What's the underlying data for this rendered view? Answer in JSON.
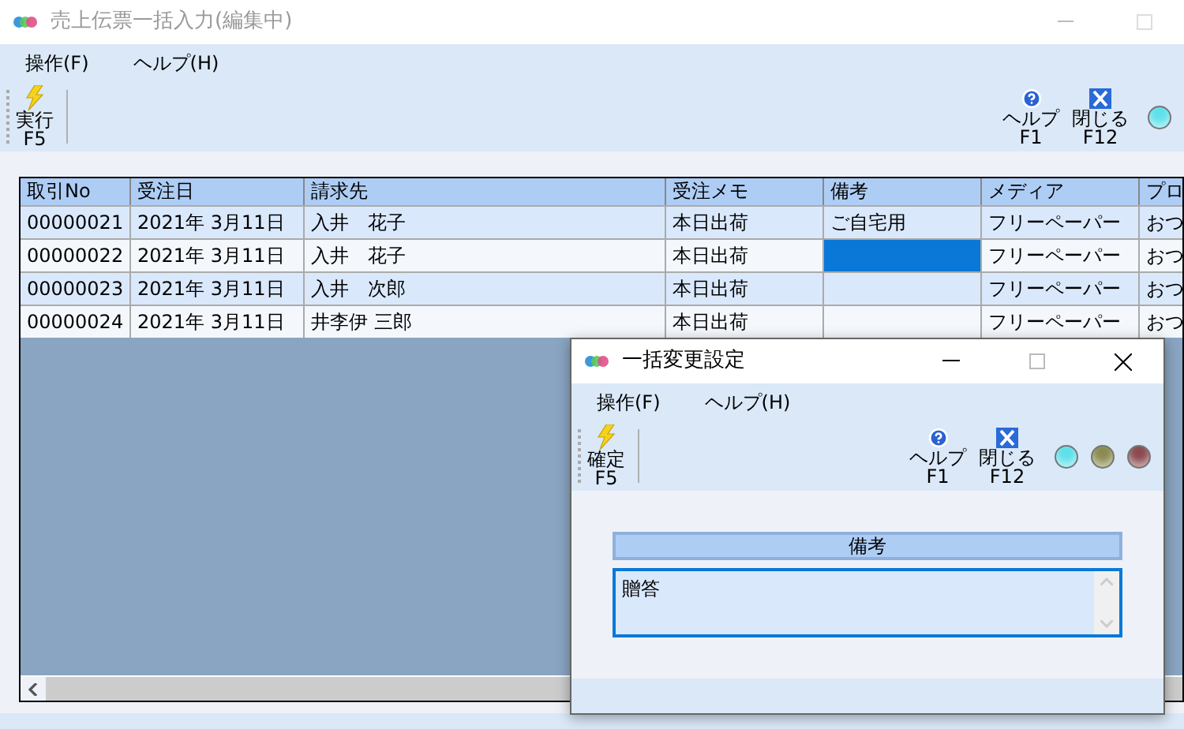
{
  "window": {
    "title": "売上伝票一括入力(編集中)"
  },
  "menu": [
    "操作(F)",
    "ヘルプ(H)"
  ],
  "toolbar": {
    "left": [
      {
        "kind": "run",
        "label": "実行",
        "key": "F5"
      }
    ],
    "right": [
      {
        "kind": "help",
        "label": "ヘルプ",
        "key": "F1"
      },
      {
        "kind": "close",
        "label": "閉じる",
        "key": "F12"
      }
    ],
    "lamps": [
      {
        "color": "#5ee0ea"
      }
    ]
  },
  "table": {
    "columns": [
      "取引No",
      "受注日",
      "請求先",
      "受注メモ",
      "備考",
      "メディア",
      "プロ"
    ],
    "rows": [
      {
        "cells": [
          {
            "text": "00000021",
            "selected": false
          },
          {
            "text": "2021年 3月11日",
            "selected": false
          },
          {
            "text": "入井　花子",
            "selected": false
          },
          {
            "text": "本日出荷",
            "selected": false
          },
          {
            "text": "ご自宅用",
            "selected": false
          },
          {
            "text": "フリーペーパー",
            "selected": false
          },
          {
            "text": "おつ",
            "selected": false
          }
        ]
      },
      {
        "cells": [
          {
            "text": "00000022",
            "selected": false
          },
          {
            "text": "2021年 3月11日",
            "selected": false
          },
          {
            "text": "入井　花子",
            "selected": false
          },
          {
            "text": "本日出荷",
            "selected": false
          },
          {
            "text": "",
            "selected": true
          },
          {
            "text": "フリーペーパー",
            "selected": false
          },
          {
            "text": "おつ",
            "selected": false
          }
        ]
      },
      {
        "cells": [
          {
            "text": "00000023",
            "selected": false
          },
          {
            "text": "2021年 3月11日",
            "selected": false
          },
          {
            "text": "入井　次郎",
            "selected": false
          },
          {
            "text": "本日出荷",
            "selected": false
          },
          {
            "text": "",
            "selected": false
          },
          {
            "text": "フリーペーパー",
            "selected": false
          },
          {
            "text": "おつ",
            "selected": false
          }
        ]
      },
      {
        "cells": [
          {
            "text": "00000024",
            "selected": false
          },
          {
            "text": "2021年 3月11日",
            "selected": false
          },
          {
            "text": "井李伊 三郎",
            "selected": false
          },
          {
            "text": "本日出荷",
            "selected": false
          },
          {
            "text": "",
            "selected": false
          },
          {
            "text": "フリーペーパー",
            "selected": false
          },
          {
            "text": "おつ",
            "selected": false
          }
        ]
      }
    ]
  },
  "dialog": {
    "title": "一括変更設定",
    "menu": [
      "操作(F)",
      "ヘルプ(H)"
    ],
    "toolbar": {
      "left": [
        {
          "kind": "run",
          "label": "確定",
          "key": "F5"
        }
      ],
      "right": [
        {
          "kind": "help",
          "label": "ヘルプ",
          "key": "F1"
        },
        {
          "kind": "close",
          "label": "閉じる",
          "key": "F12"
        }
      ],
      "lamps": [
        {
          "color": "#5ee0ea"
        },
        {
          "color": "#8a8a50"
        },
        {
          "color": "#8a4a50"
        }
      ]
    },
    "field": {
      "label": "備考",
      "value": "贈答"
    }
  }
}
